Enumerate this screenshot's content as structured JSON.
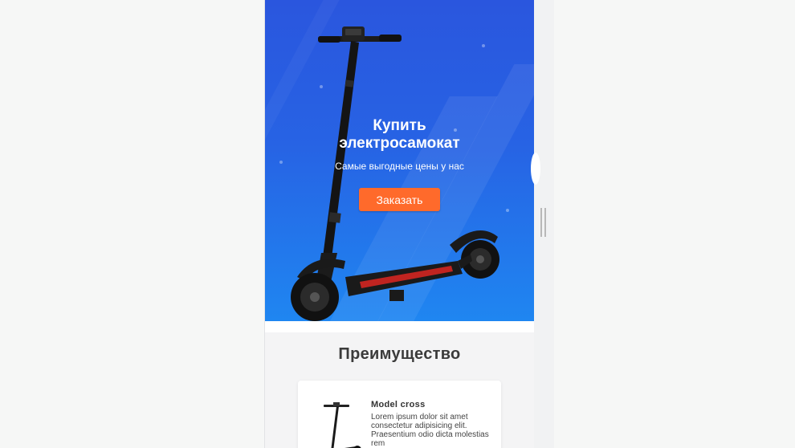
{
  "hero": {
    "title": "Купить электросамокат",
    "subtitle": "Самые выгодные цены у нас",
    "order_button": "Заказать"
  },
  "advantages": {
    "heading": "Преимущество",
    "cards": [
      {
        "title": "Model cross",
        "text": "Lorem ipsum dolor sit amet consectetur adipisicing elit. Praesentium odio dicta molestias rem"
      }
    ]
  },
  "colors": {
    "hero_top": "#2a56de",
    "hero_bottom": "#1f86f1",
    "accent_button": "#ff6a2b",
    "page_bg": "#f6f7f6"
  },
  "icons": [
    "scooter-image",
    "scooter-thumbnail",
    "resize-handle-icon"
  ]
}
